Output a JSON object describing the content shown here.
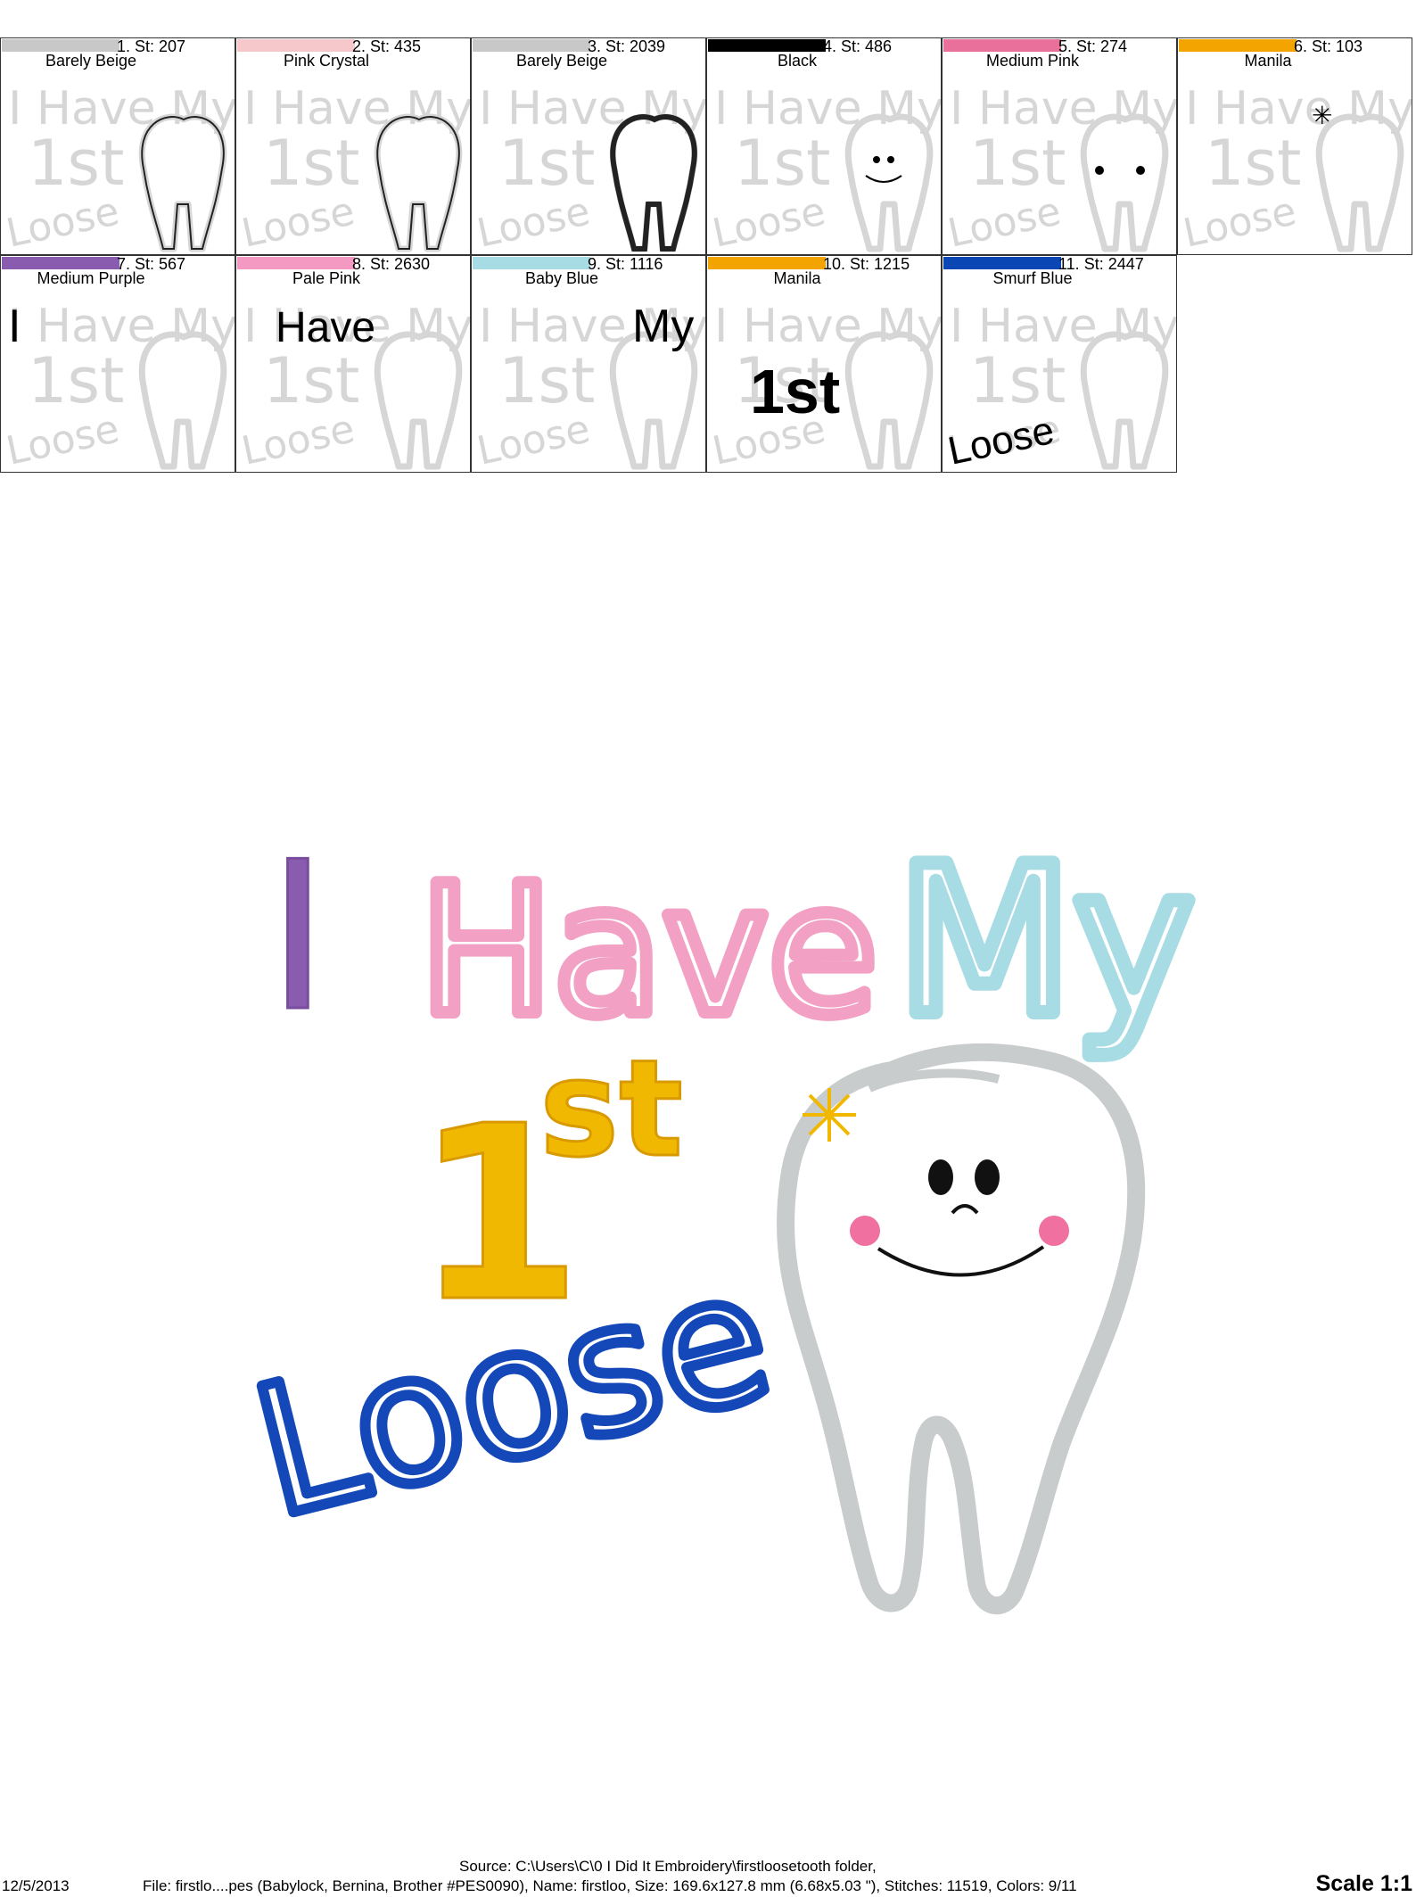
{
  "thumbnails": [
    {
      "label": "1. St: 207",
      "name": "Barely Beige",
      "color": "#c8c8c8"
    },
    {
      "label": "2. St: 435",
      "name": "Pink Crystal",
      "color": "#f6c8cc"
    },
    {
      "label": "3. St: 2039",
      "name": "Barely Beige",
      "color": "#c8c8c8"
    },
    {
      "label": "4. St: 486",
      "name": "Black",
      "color": "#000000"
    },
    {
      "label": "5. St: 274",
      "name": "Medium Pink",
      "color": "#e8709a"
    },
    {
      "label": "6. St: 103",
      "name": "Manila",
      "color": "#f4a400"
    },
    {
      "label": "7. St: 567",
      "name": "Medium Purple",
      "color": "#8a5cb0"
    },
    {
      "label": "8. St: 2630",
      "name": "Pale Pink",
      "color": "#f49ac2"
    },
    {
      "label": "9. St: 1116",
      "name": "Baby Blue",
      "color": "#a8dce4"
    },
    {
      "label": "10. St: 1215",
      "name": "Manila",
      "color": "#f4a400"
    },
    {
      "label": "11. St: 2447",
      "name": "Smurf Blue",
      "color": "#0a46b4"
    }
  ],
  "design": {
    "word_i": "I",
    "word_have": "Have",
    "word_my": "My",
    "word_1": "1",
    "word_st": "st",
    "word_loose": "Loose",
    "colors": {
      "purple": "#8a5cb0",
      "pink": "#f2a0c4",
      "blue_light": "#a8dce4",
      "gold": "#f0b800",
      "royal": "#1448b8",
      "tooth_outline": "#c8cccc",
      "cheek": "#f070a0"
    }
  },
  "footer": {
    "source": "Source: C:\\Users\\C\\0 I Did It Embroidery\\firstloosetooth folder,",
    "date": "12/5/2013",
    "file": "File: firstlo....pes (Babylock, Bernina, Brother #PES0090), Name: firstloo, Size: 169.6x127.8 mm (6.68x5.03 \"), Stitches: 11519, Colors: 9/11",
    "scale": "Scale 1:1"
  }
}
